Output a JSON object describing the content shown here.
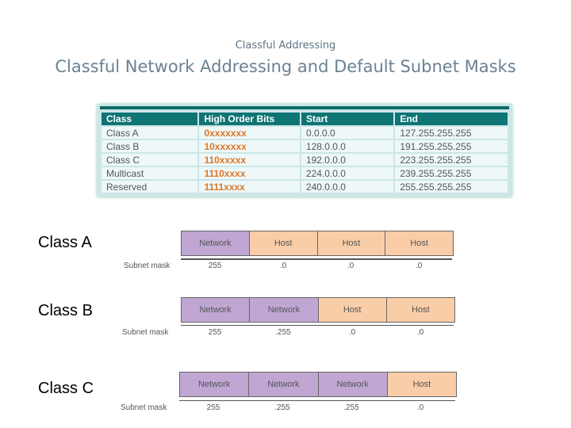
{
  "header": {
    "subtitle": "Classful Addressing",
    "title": "Classful Network Addressing and Default Subnet Masks"
  },
  "table": {
    "columns": [
      "Class",
      "High Order Bits",
      "Start",
      "End"
    ],
    "rows": [
      [
        "Class A",
        "0xxxxxxx",
        "0.0.0.0",
        "127.255.255.255"
      ],
      [
        "Class B",
        "10xxxxxx",
        "128.0.0.0",
        "191.255.255.255"
      ],
      [
        "Class C",
        "110xxxxx",
        "192.0.0.0",
        "223.255.255.255"
      ],
      [
        "Multicast",
        "1110xxxx",
        "224.0.0.0",
        "239.255.255.255"
      ],
      [
        "Reserved",
        "1111xxxx",
        "240.0.0.0",
        "255.255.255.255"
      ]
    ],
    "colors": {
      "header_bg": "#0f7474",
      "bits_text": "#e07526",
      "row_bg": "#eef8f8"
    }
  },
  "diagrams": [
    {
      "label": "Class A",
      "segments": [
        "Network",
        "Host",
        "Host",
        "Host"
      ],
      "mask_label": "Subnet mask",
      "mask": [
        "255",
        ".0",
        ".0",
        ".0"
      ]
    },
    {
      "label": "Class B",
      "segments": [
        "Network",
        "Network",
        "Host",
        "Host"
      ],
      "mask_label": "Subnet mask",
      "mask": [
        "255",
        ".255",
        ".0",
        ".0"
      ]
    },
    {
      "label": "Class C",
      "segments": [
        "Network",
        "Network",
        "Network",
        "Host"
      ],
      "mask_label": "Subnet mask",
      "mask": [
        "255",
        ".255",
        ".255",
        ".0"
      ]
    }
  ],
  "colors": {
    "network": "#bfa6d3",
    "host": "#f9cda7"
  }
}
